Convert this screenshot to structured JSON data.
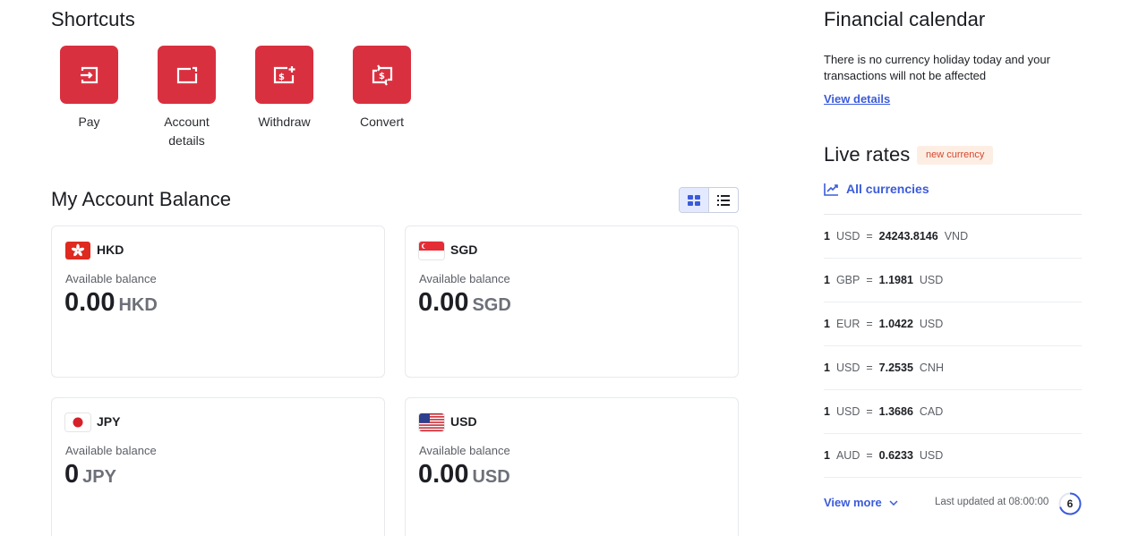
{
  "shortcuts": {
    "title": "Shortcuts",
    "items": [
      {
        "label": "Pay",
        "icon": "pay-icon"
      },
      {
        "label": "Account\ndetails",
        "icon": "account-details-icon"
      },
      {
        "label": "Withdraw",
        "icon": "withdraw-icon"
      },
      {
        "label": "Convert",
        "icon": "convert-icon"
      }
    ]
  },
  "balance": {
    "title": "My Account Balance",
    "view_toggle": {
      "active": "grid",
      "options": [
        "grid-view-icon",
        "list-view-icon"
      ]
    },
    "cards": [
      {
        "currency": "HKD",
        "available_label": "Available balance",
        "amount": "0.00",
        "code": "HKD"
      },
      {
        "currency": "SGD",
        "available_label": "Available balance",
        "amount": "0.00",
        "code": "SGD"
      },
      {
        "currency": "JPY",
        "available_label": "Available balance",
        "amount": "0",
        "code": "JPY"
      },
      {
        "currency": "USD",
        "available_label": "Available balance",
        "amount": "0.00",
        "code": "USD"
      }
    ]
  },
  "calendar": {
    "title": "Financial calendar",
    "message": "There is no currency holiday today and your transactions will not be affected",
    "link": "View details"
  },
  "rates": {
    "title": "Live rates",
    "badge": "new currency",
    "all_currencies": "All currencies",
    "rows": [
      {
        "qty": "1",
        "from": "USD",
        "eq": "=",
        "rate": "24243.8146",
        "to": "VND"
      },
      {
        "qty": "1",
        "from": "GBP",
        "eq": "=",
        "rate": "1.1981",
        "to": "USD"
      },
      {
        "qty": "1",
        "from": "EUR",
        "eq": "=",
        "rate": "1.0422",
        "to": "USD"
      },
      {
        "qty": "1",
        "from": "USD",
        "eq": "=",
        "rate": "7.2535",
        "to": "CNH"
      },
      {
        "qty": "1",
        "from": "USD",
        "eq": "=",
        "rate": "1.3686",
        "to": "CAD"
      },
      {
        "qty": "1",
        "from": "AUD",
        "eq": "=",
        "rate": "0.6233",
        "to": "USD"
      }
    ],
    "view_more": "View more",
    "last_updated": "Last updated at 08:00:00",
    "countdown": "6"
  },
  "colors": {
    "accent": "#d9303f",
    "link": "#3b5bdb",
    "badge_bg": "#fdeee4",
    "badge_text": "#d6462e"
  }
}
